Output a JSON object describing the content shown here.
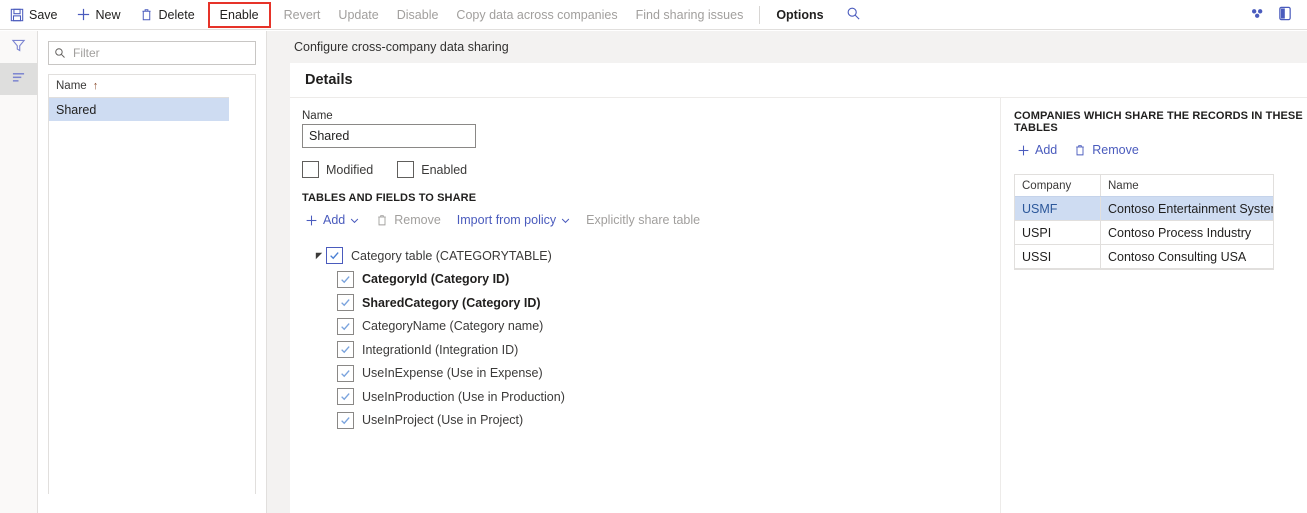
{
  "toolbar": {
    "items": [
      {
        "label": "Save",
        "icon": "save-icon",
        "state": "enabled"
      },
      {
        "label": "New",
        "icon": "plus-icon",
        "state": "enabled"
      },
      {
        "label": "Delete",
        "icon": "trash-icon",
        "state": "enabled"
      },
      {
        "label": "Enable",
        "icon": "none",
        "state": "enabled",
        "highlighted": true
      },
      {
        "label": "Revert",
        "icon": "none",
        "state": "disabled"
      },
      {
        "label": "Update",
        "icon": "none",
        "state": "disabled"
      },
      {
        "label": "Disable",
        "icon": "none",
        "state": "disabled"
      },
      {
        "label": "Copy data across companies",
        "icon": "none",
        "state": "disabled"
      },
      {
        "label": "Find sharing issues",
        "icon": "none",
        "state": "disabled"
      }
    ],
    "options_label": "Options",
    "search_icon": "search-icon",
    "right_icons": [
      {
        "name": "personalize-icon"
      },
      {
        "name": "open-in-new-window-icon"
      }
    ],
    "highlight_color": "#e63329",
    "accent_color": "#4a5bbd"
  },
  "rail": {
    "items": [
      {
        "name": "filter-pane-icon",
        "icon": "funnel-icon",
        "active": false
      },
      {
        "name": "list-pane-icon",
        "icon": "lines-icon",
        "active": true
      }
    ]
  },
  "list_pane": {
    "filter": {
      "value": "",
      "placeholder": "Filter",
      "icon": "search-icon"
    },
    "grid": {
      "header": "Name",
      "sort_indicator": "↑",
      "rows": [
        {
          "name": "Shared",
          "selected": true
        }
      ]
    }
  },
  "page": {
    "title": "Configure cross-company data sharing",
    "card_title": "Details"
  },
  "details": {
    "name_label": "Name",
    "name_value": "Shared",
    "checkboxes": [
      {
        "label": "Modified",
        "checked": false
      },
      {
        "label": "Enabled",
        "checked": false
      }
    ]
  },
  "tables_section": {
    "title": "TABLES AND FIELDS TO SHARE",
    "actions": [
      {
        "label": "Add",
        "icon": "plus-icon",
        "state": "enabled",
        "chevron": true
      },
      {
        "label": "Remove",
        "icon": "trash-icon",
        "state": "disabled",
        "chevron": false
      },
      {
        "label": "Import from policy",
        "icon": "none",
        "state": "enabled",
        "chevron": true
      },
      {
        "label": "Explicitly share table",
        "icon": "none",
        "state": "disabled",
        "chevron": false
      }
    ],
    "tree": {
      "root": {
        "label": "Category table (CATEGORYTABLE)",
        "checked": true,
        "focused": true,
        "expanded": true,
        "bold": false
      },
      "children": [
        {
          "label": "CategoryId (Category ID)",
          "checked": true,
          "bold": true
        },
        {
          "label": "SharedCategory (Category ID)",
          "checked": true,
          "bold": true
        },
        {
          "label": "CategoryName (Category name)",
          "checked": true,
          "bold": false
        },
        {
          "label": "IntegrationId (Integration ID)",
          "checked": true,
          "bold": false
        },
        {
          "label": "UseInExpense (Use in Expense)",
          "checked": true,
          "bold": false
        },
        {
          "label": "UseInProduction (Use in Production)",
          "checked": true,
          "bold": false
        },
        {
          "label": "UseInProject (Use in Project)",
          "checked": true,
          "bold": false
        }
      ]
    }
  },
  "companies_section": {
    "title": "COMPANIES WHICH SHARE THE RECORDS IN THESE TABLES",
    "actions": [
      {
        "label": "Add",
        "icon": "plus-icon",
        "state": "enabled"
      },
      {
        "label": "Remove",
        "icon": "trash-icon",
        "state": "enabled"
      }
    ],
    "grid": {
      "columns": [
        "Company",
        "Name"
      ],
      "rows": [
        {
          "company": "USMF",
          "name": "Contoso Entertainment System ...",
          "selected": true
        },
        {
          "company": "USPI",
          "name": "Contoso Process Industry",
          "selected": false
        },
        {
          "company": "USSI",
          "name": "Contoso Consulting USA",
          "selected": false
        }
      ]
    }
  }
}
